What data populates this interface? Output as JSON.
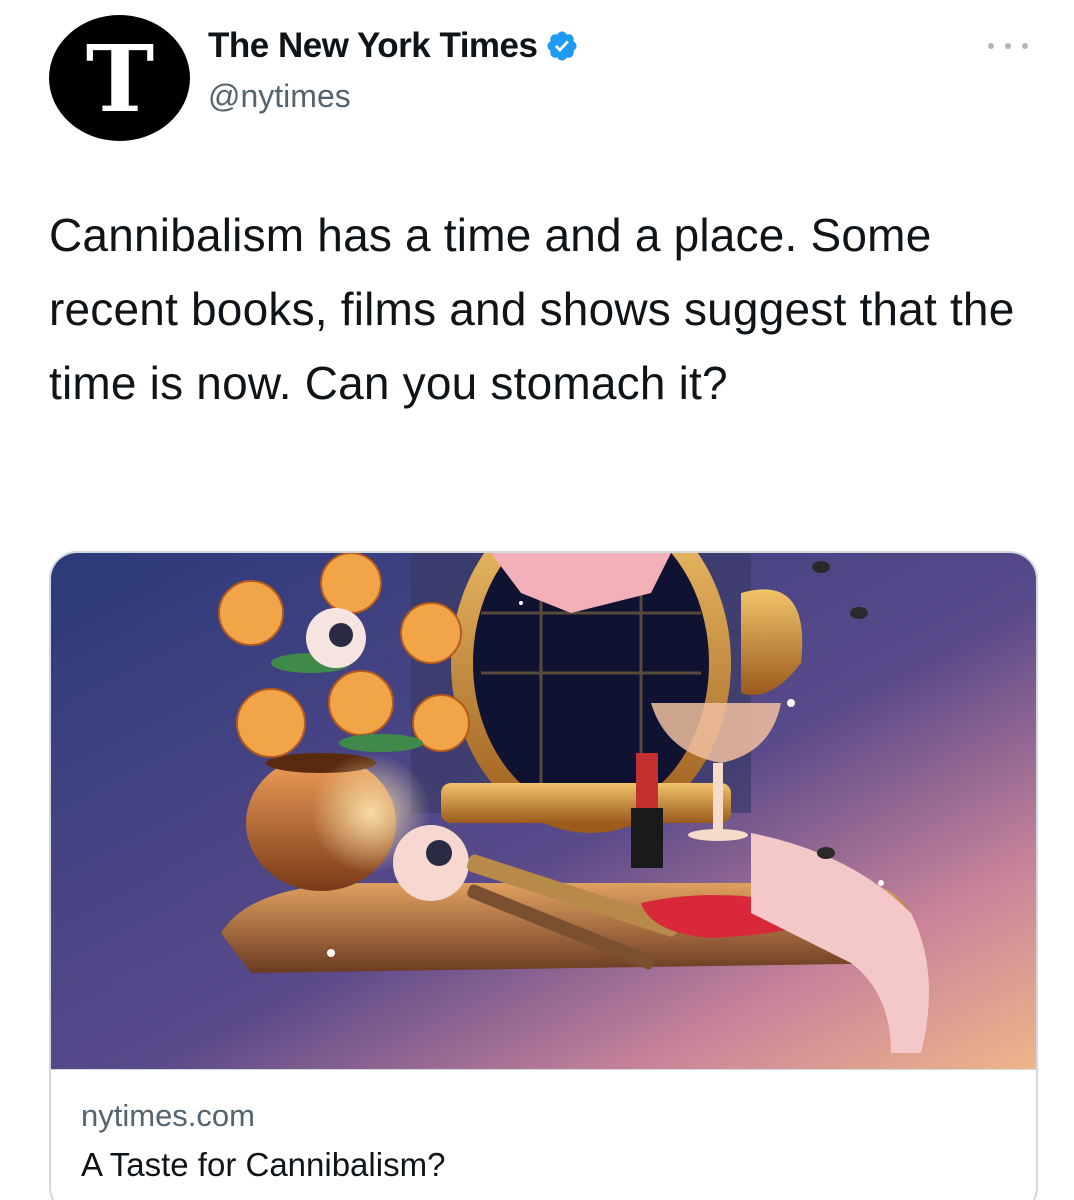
{
  "author": {
    "display_name": "The New York Times",
    "handle": "@nytimes",
    "verified": true,
    "avatar_icon": "nyt-logo-icon",
    "avatar_letter": "T"
  },
  "tweet": {
    "text": "Cannibalism has a time and a place. Some recent books, films and shows suggest that the time is now. Can you stomach it?"
  },
  "card": {
    "domain": "nytimes.com",
    "title": "A Taste for Cannibalism?",
    "image_icon": "illustration-image"
  },
  "icons": {
    "more": "more-options-icon",
    "verified": "verified-badge-icon"
  },
  "colors": {
    "verified_blue": "#1d9bf0",
    "text_primary": "#0f1419",
    "text_secondary": "#536471",
    "border": "#cfd9de"
  }
}
